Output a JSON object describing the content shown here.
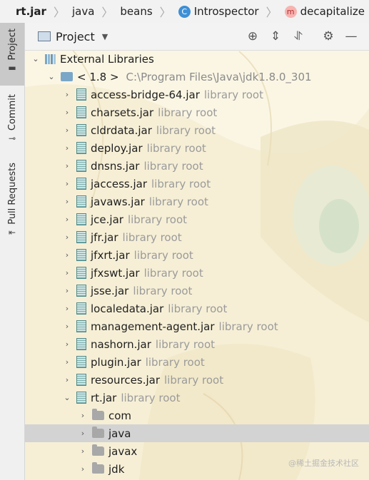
{
  "breadcrumb": {
    "items": [
      "rt.jar",
      "java",
      "beans",
      "Introspector",
      "decapitalize"
    ],
    "class_badge": "C",
    "method_badge": "m"
  },
  "side_tabs": {
    "project": "Project",
    "commit": "Commit",
    "pull_requests": "Pull Requests"
  },
  "panel": {
    "title": "Project",
    "tools": [
      "locate-icon",
      "expand-all-icon",
      "collapse-all-icon",
      "gear-icon",
      "minimize-icon"
    ]
  },
  "tree": {
    "external_libraries": "External Libraries",
    "jdk_label": "< 1.8 >",
    "jdk_path": "C:\\Program Files\\Java\\jdk1.8.0_301",
    "jars": [
      {
        "name": "access-bridge-64.jar",
        "hint": "library root"
      },
      {
        "name": "charsets.jar",
        "hint": "library root"
      },
      {
        "name": "cldrdata.jar",
        "hint": "library root"
      },
      {
        "name": "deploy.jar",
        "hint": "library root"
      },
      {
        "name": "dnsns.jar",
        "hint": "library root"
      },
      {
        "name": "jaccess.jar",
        "hint": "library root"
      },
      {
        "name": "javaws.jar",
        "hint": "library root"
      },
      {
        "name": "jce.jar",
        "hint": "library root"
      },
      {
        "name": "jfr.jar",
        "hint": "library root"
      },
      {
        "name": "jfxrt.jar",
        "hint": "library root"
      },
      {
        "name": "jfxswt.jar",
        "hint": "library root"
      },
      {
        "name": "jsse.jar",
        "hint": "library root"
      },
      {
        "name": "localedata.jar",
        "hint": "library root"
      },
      {
        "name": "management-agent.jar",
        "hint": "library root"
      },
      {
        "name": "nashorn.jar",
        "hint": "library root"
      },
      {
        "name": "plugin.jar",
        "hint": "library root"
      },
      {
        "name": "resources.jar",
        "hint": "library root"
      },
      {
        "name": "rt.jar",
        "hint": "library root"
      }
    ],
    "rt_packages": [
      "com",
      "java",
      "javax",
      "jdk"
    ]
  },
  "watermark": "@稀土掘金技术社区"
}
